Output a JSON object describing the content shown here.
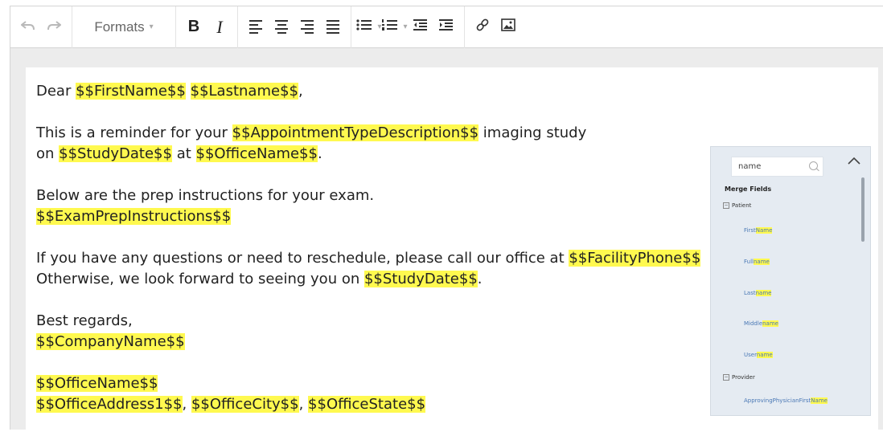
{
  "toolbar": {
    "undo_icon": "undo-icon",
    "redo_icon": "redo-icon",
    "formats_label": "Formats",
    "bold_label": "B",
    "italic_label": "I"
  },
  "letter": {
    "line1": {
      "p1": "Dear ",
      "f1": "$$FirstName$$",
      "p2": " ",
      "f2": "$$Lastname$$",
      "p3": ","
    },
    "line2": {
      "p1": "This is a reminder for your ",
      "f1": "$$AppointmentTypeDescription$$",
      "p2": " imaging study"
    },
    "line3": {
      "p1": "on ",
      "f1": "$$StudyDate$$",
      "p2": " at ",
      "f2": "$$OfficeName$$",
      "p3": "."
    },
    "line4": {
      "p1": "Below are the prep instructions for your exam."
    },
    "line5": {
      "f1": "$$ExamPrepInstructions$$"
    },
    "line6": {
      "p1": "If you have any questions or need to reschedule, please call our office at ",
      "f1": "$$FacilityPhone$$"
    },
    "line7": {
      "p1": "Otherwise, we look forward to seeing you on ",
      "f1": "$$StudyDate$$",
      "p2": "."
    },
    "line8": {
      "p1": "Best regards,"
    },
    "line9": {
      "f1": "$$CompanyName$$"
    },
    "line10": {
      "f1": "$$OfficeName$$"
    },
    "line11": {
      "f1": "$$OfficeAddress1$$",
      "p1": ", ",
      "f2": "$$OfficeCity$$",
      "p2": ", ",
      "f3": "$$OfficeState$$"
    }
  },
  "merge_fields": {
    "search_value": "name",
    "header": "Merge Fields",
    "groups": [
      {
        "label": "Patient",
        "items": [
          {
            "pre": "First",
            "match": "Name",
            "post": ""
          },
          {
            "pre": "Full",
            "match": "name",
            "post": ""
          },
          {
            "pre": "Last",
            "match": "name",
            "post": ""
          },
          {
            "pre": "Middle",
            "match": "name",
            "post": ""
          },
          {
            "pre": "User",
            "match": "name",
            "post": ""
          }
        ]
      },
      {
        "label": "Provider",
        "items": [
          {
            "pre": "ApprovingPhysicianFirst",
            "match": "Name",
            "post": ""
          }
        ]
      }
    ]
  },
  "colors": {
    "highlight": "#fff94f",
    "panel_bg": "#e5ebf2",
    "link": "#4a78b5"
  }
}
